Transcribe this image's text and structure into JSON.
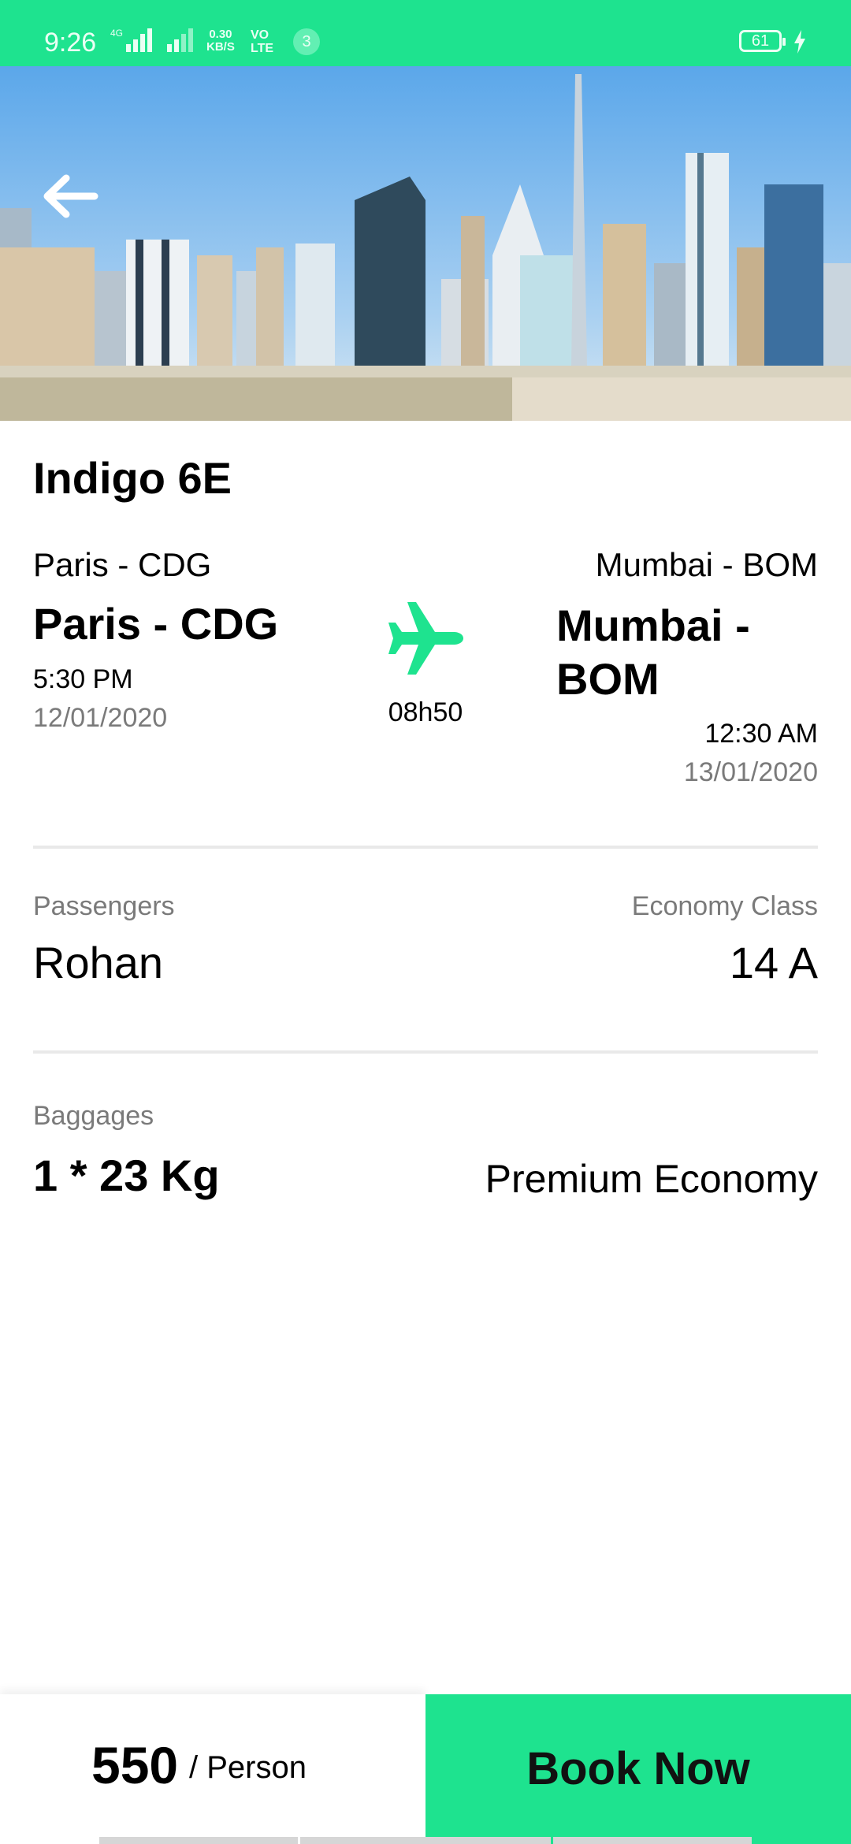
{
  "status_bar": {
    "time": "9:26",
    "network": "4G",
    "speed_top": "0.30",
    "speed_bottom": "KB/S",
    "volte_top": "VO",
    "volte_bottom": "LTE",
    "notification_count": "3",
    "battery": "61",
    "background_color": "#1ee38f"
  },
  "header": {
    "back_icon": "arrow-left-icon"
  },
  "flight": {
    "airline": "Indigo 6E",
    "departure": {
      "city_code_small": "Paris - CDG",
      "city_code": "Paris - CDG",
      "time": "5:30 PM",
      "date": "12/01/2020"
    },
    "plane_icon": "airplane-icon",
    "duration": "08h50",
    "arrival": {
      "city_code_small": "Mumbai - BOM",
      "city_code": "Mumbai - BOM",
      "time": "12:30 AM",
      "date": "13/01/2020"
    }
  },
  "passengers": {
    "label": "Passengers",
    "name": "Rohan",
    "class_label": "Economy Class",
    "seat": "14 A"
  },
  "baggage": {
    "label": "Baggages",
    "value": "1 * 23 Kg",
    "cabin": "Premium Economy"
  },
  "footer": {
    "price": "550",
    "per_label": "/ Person",
    "book_label": "Book Now",
    "accent_color": "#1ee38f"
  }
}
